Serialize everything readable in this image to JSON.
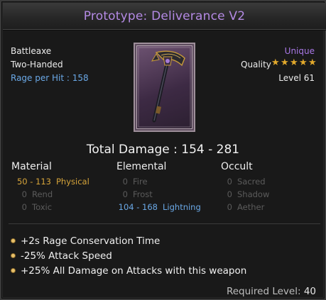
{
  "item": {
    "name": "Prototype: Deliverance V2",
    "type": "Battleaxe",
    "handedness": "Two-Handed",
    "rage_per_hit": "Rage per Hit : 158",
    "rarity": "Unique",
    "quality_label": "Quality",
    "quality_stars": 5,
    "level": "Level 61"
  },
  "damage": {
    "total": "Total Damage : 154 - 281",
    "columns": [
      "Material",
      "Elemental",
      "Occult"
    ],
    "material": [
      {
        "value": "50 - 113",
        "label": "Physical"
      },
      {
        "value": "0",
        "label": "Rend"
      },
      {
        "value": "0",
        "label": "Toxic"
      }
    ],
    "elemental": [
      {
        "value": "0",
        "label": "Fire"
      },
      {
        "value": "0",
        "label": "Frost"
      },
      {
        "value": "104 - 168",
        "label": "Lightning"
      }
    ],
    "occult": [
      {
        "value": "0",
        "label": "Sacred"
      },
      {
        "value": "0",
        "label": "Shadow"
      },
      {
        "value": "0",
        "label": "Aether"
      }
    ]
  },
  "modifiers": [
    "+2s Rage Conservation Time",
    "-25% Attack Speed",
    "+25% All Damage on Attacks with this weapon"
  ],
  "requirement": {
    "label": "Required Level:",
    "value": "40"
  },
  "icons": [
    "battleaxe-icon",
    "star-icon",
    "bullet-icon"
  ],
  "colors": {
    "title": "#b48ae4",
    "rarity": "#a978e6",
    "rage": "#6aa8e6",
    "physical": "#d6a43a",
    "lightning": "#6aa8e6",
    "inactive": "#5b5b5b",
    "stars": "#e2a92c"
  }
}
